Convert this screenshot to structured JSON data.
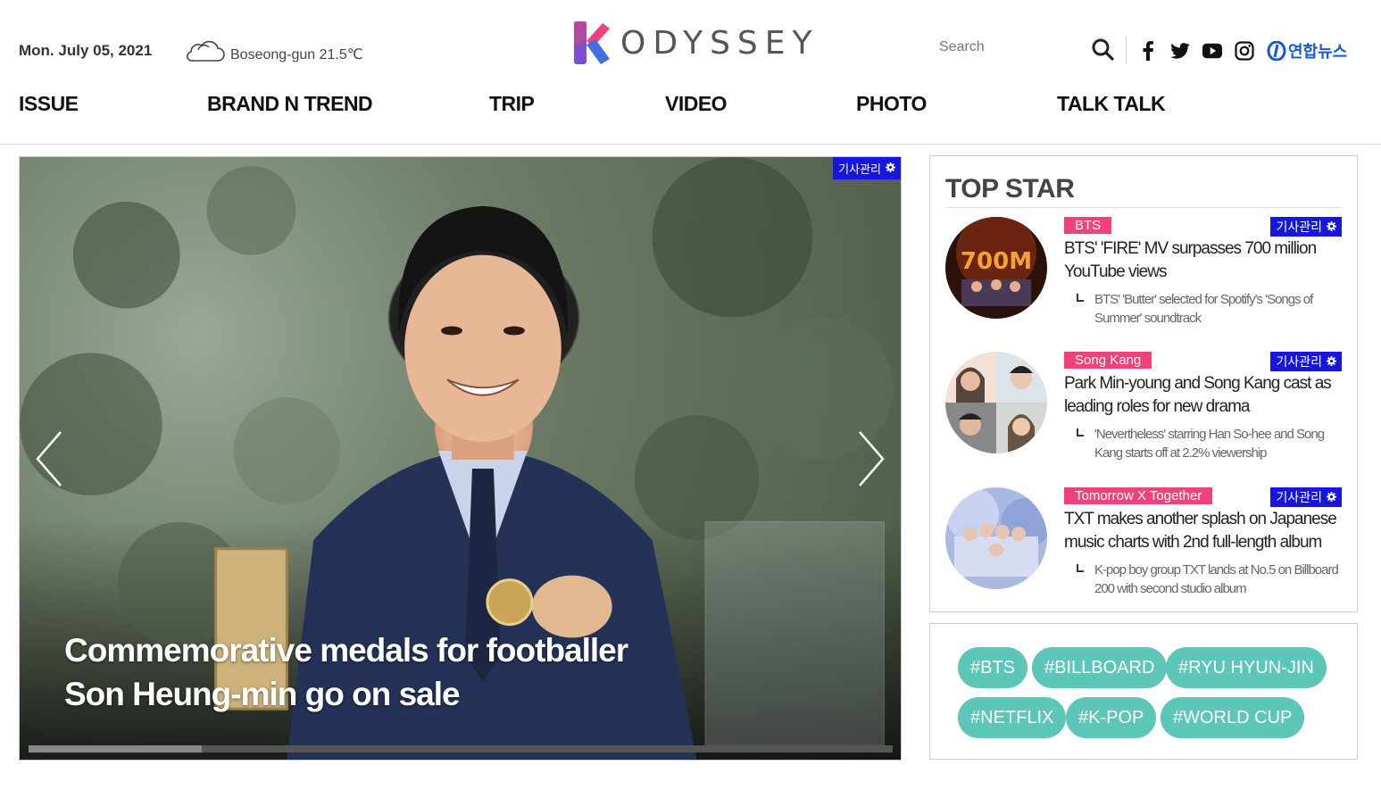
{
  "header": {
    "date": "Mon. July 05, 2021",
    "weather": "Boseong-gun 21.5℃",
    "logo_text": "ODYSSEY",
    "search_placeholder": "Search",
    "partner": "연합뉴스"
  },
  "nav": [
    "ISSUE",
    "BRAND N TREND",
    "TRIP",
    "VIDEO",
    "PHOTO",
    "TALK TALK"
  ],
  "hero": {
    "admin_label": "기사관리",
    "title_line1": "Commemorative medals for footballer",
    "title_line2": "Son Heung-min go on sale",
    "progress": 0.2
  },
  "top_star": {
    "heading": "TOP STAR",
    "admin_label": "기사관리",
    "items": [
      {
        "tag": "BTS",
        "title": "BTS' 'FIRE' MV surpasses 700 million YouTube views",
        "sub": "BTS' 'Butter' selected for Spotify's 'Songs of Summer' soundtrack"
      },
      {
        "tag": "Song Kang",
        "title": "Park Min-young and Song Kang cast as leading roles for new drama",
        "sub": "'Nevertheless' starring Han So-hee and Song Kang starts off at 2.2% viewership"
      },
      {
        "tag": "Tomorrow X Together",
        "title": "TXT makes another splash on Japanese music charts with 2nd full-length album",
        "sub": "K-pop boy group TXT lands at No.5 on Billboard 200 with second studio album"
      }
    ]
  },
  "hashtags": [
    "#BTS",
    "#BILLBOARD",
    "#RYU HYUN-JIN",
    "#NETFLIX",
    "#K-POP",
    "#WORLD CUP"
  ],
  "colors": {
    "tag_pink": "#f0427a",
    "admin_blue": "#1616e0",
    "hashtag_teal": "#5cc6b8"
  }
}
